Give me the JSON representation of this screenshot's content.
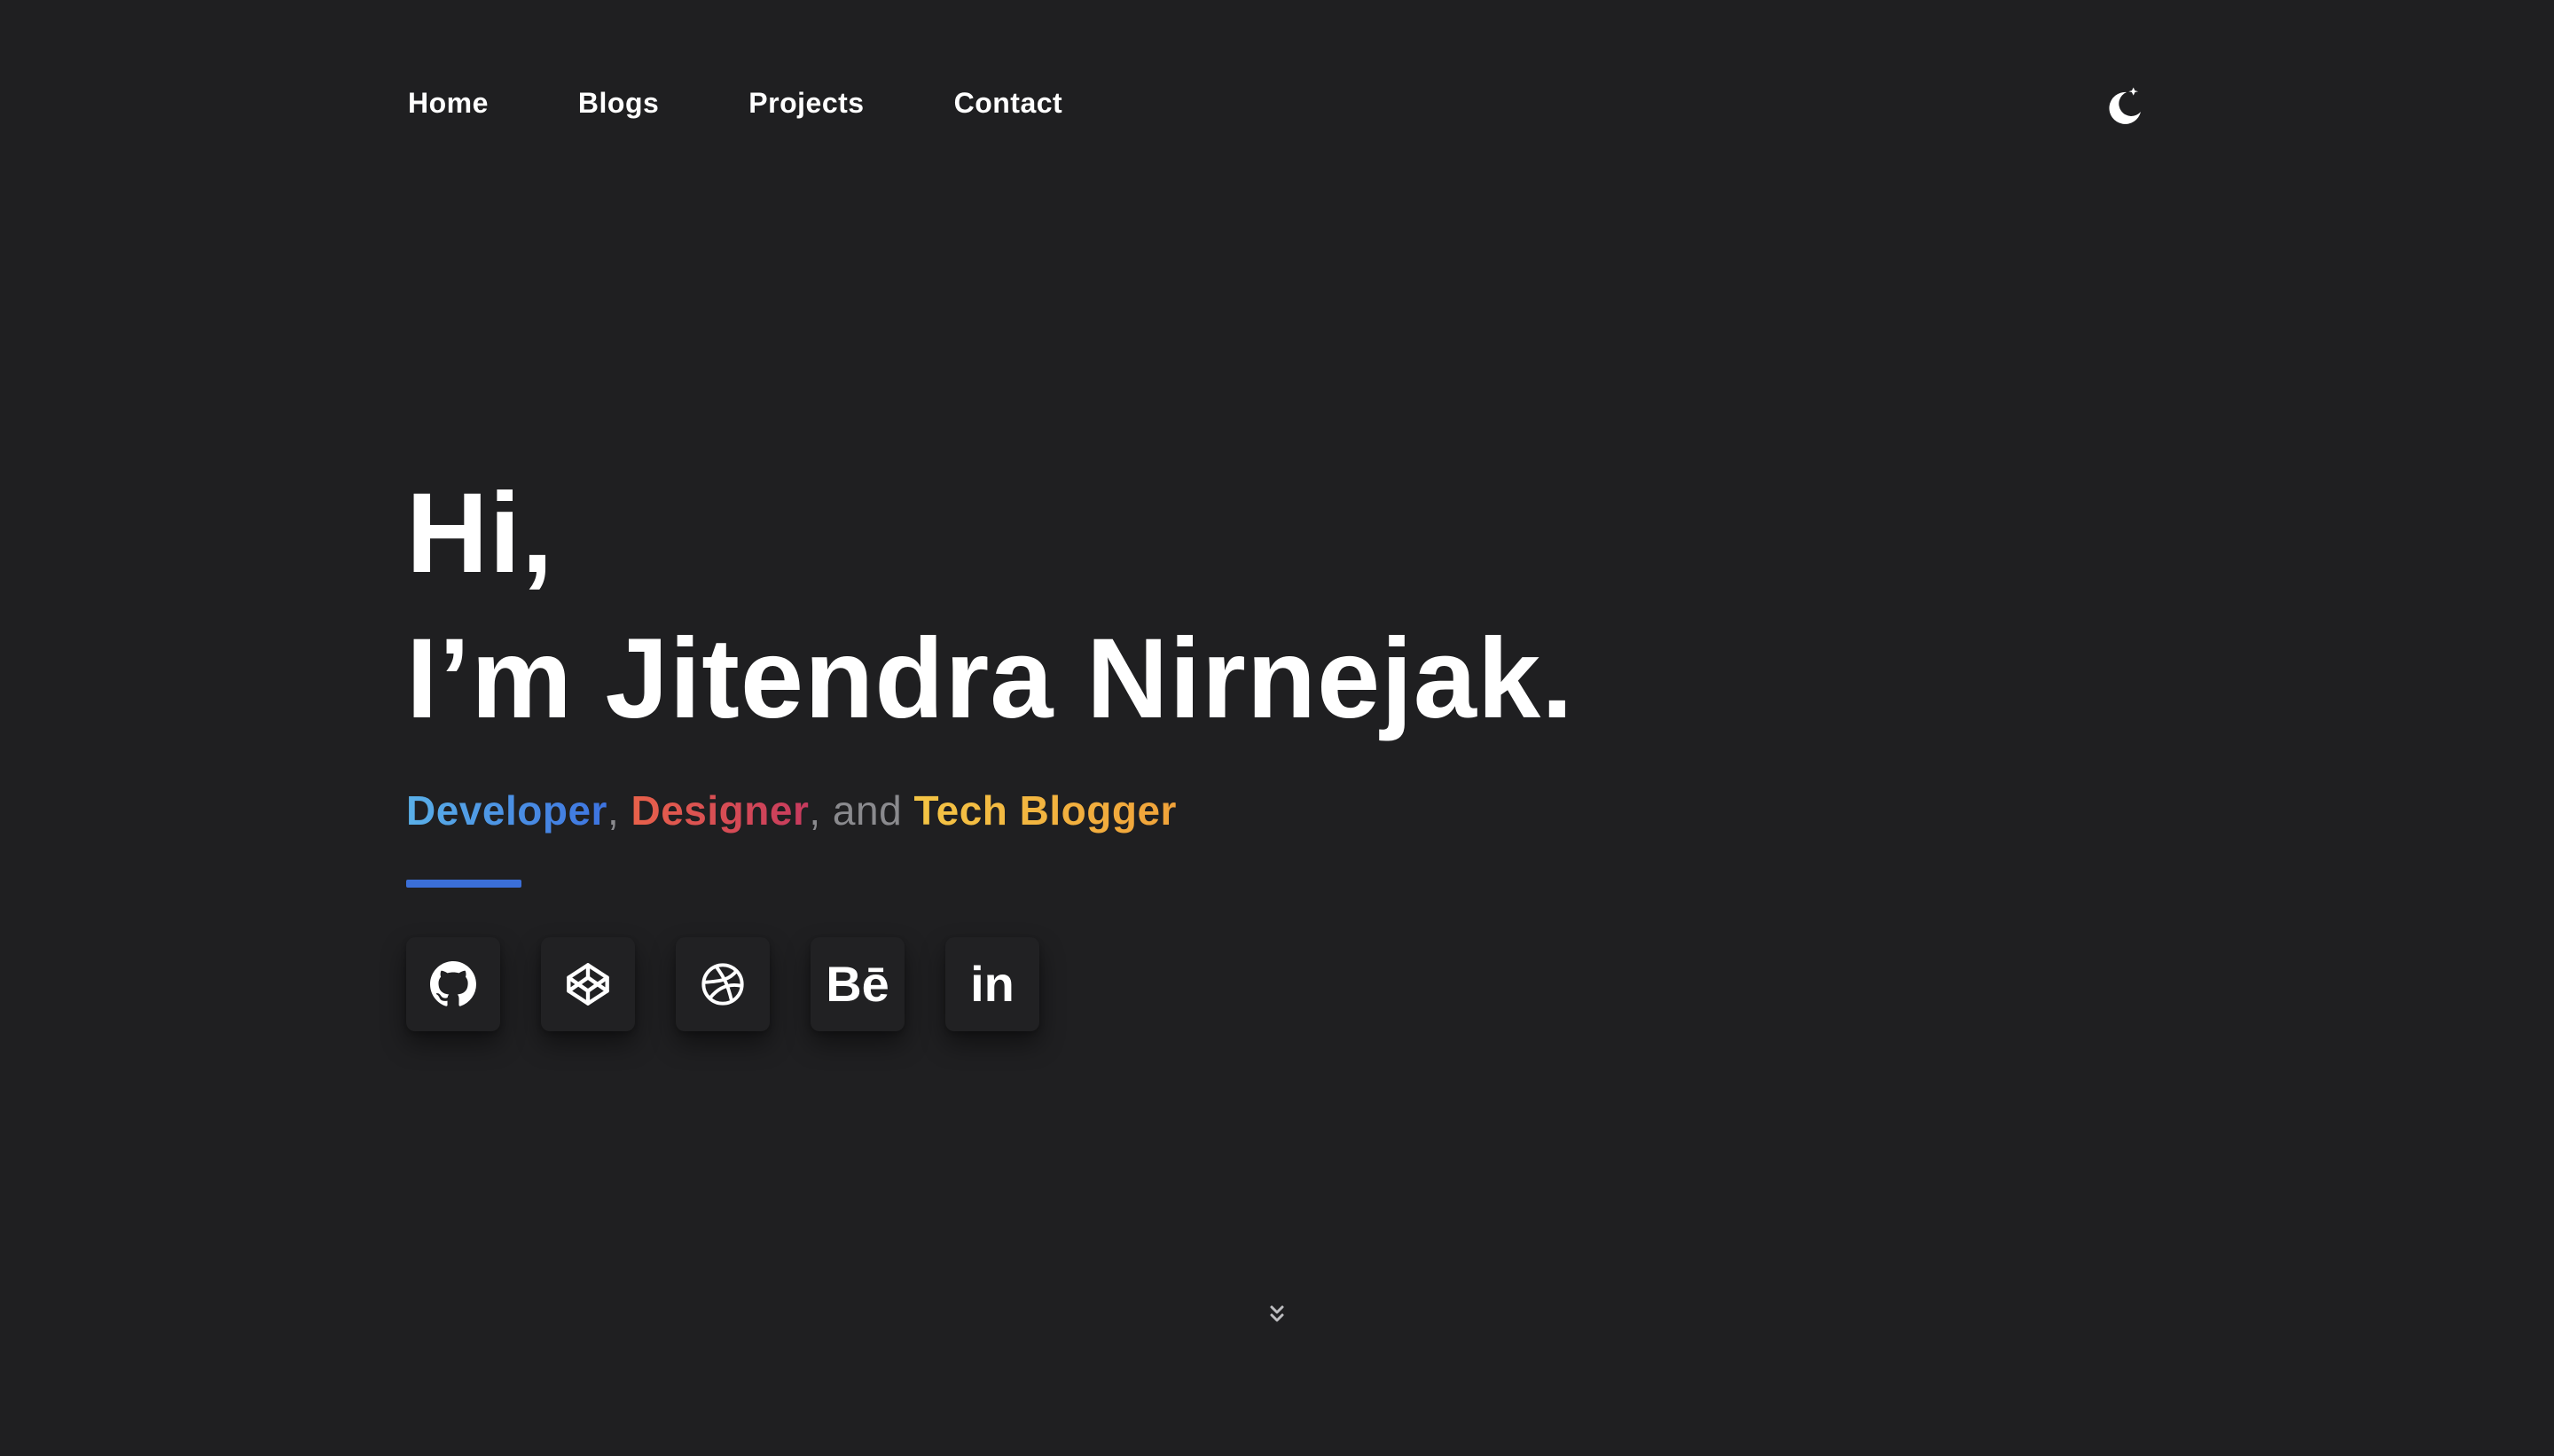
{
  "nav": {
    "items": [
      {
        "label": "Home"
      },
      {
        "label": "Blogs"
      },
      {
        "label": "Projects"
      },
      {
        "label": "Contact"
      }
    ],
    "theme_toggle_icon": "moon-stars-icon"
  },
  "hero": {
    "greeting": "Hi,",
    "intro": "I’m Jitendra Nirnejak.",
    "roles": {
      "developer": "Developer",
      "sep1": ",",
      "designer": "Designer",
      "sep2": ", and",
      "tech_blogger": "Tech Blogger"
    }
  },
  "socials": [
    {
      "name": "github",
      "icon": "github-icon"
    },
    {
      "name": "codepen",
      "icon": "codepen-icon"
    },
    {
      "name": "dribbble",
      "icon": "dribbble-icon"
    },
    {
      "name": "behance",
      "icon": "behance-icon",
      "glyph": "Bē"
    },
    {
      "name": "linkedin",
      "icon": "linkedin-icon",
      "glyph": "in"
    }
  ],
  "scroll_hint_icon": "chevrons-down-icon",
  "colors": {
    "background": "#1f1f21",
    "accent_bar": "#3b6fd8",
    "developer_gradient": [
      "#5ab0e8",
      "#3d73e0"
    ],
    "designer_gradient": [
      "#e8614a",
      "#c63a5e"
    ],
    "tech_blogger_gradient": [
      "#f4c545",
      "#f0a23a"
    ],
    "muted_text": "#8a8a8e"
  }
}
